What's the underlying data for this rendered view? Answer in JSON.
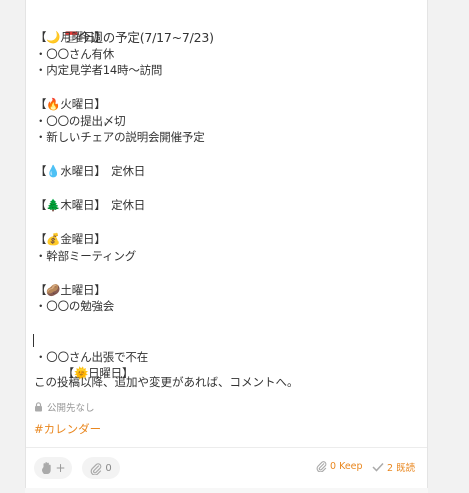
{
  "post": {
    "title": "今週の予定(7/17~7/23)",
    "monday_header": "【🌙月曜日】",
    "monday_items": [
      "・〇〇さん有休",
      "・内定見学者14時～訪問"
    ],
    "tuesday_header": "【🔥火曜日】",
    "tuesday_items": [
      "・〇〇の提出〆切",
      "・新しいチェアの説明会開催予定"
    ],
    "wednesday_line": "【💧水曜日】　定休日",
    "thursday_line": "【🌲木曜日】　定休日",
    "friday_header": "【💰金曜日】",
    "friday_items": [
      "・幹部ミーティング"
    ],
    "saturday_header": "【🥔土曜日】",
    "saturday_items": [
      "・〇〇の勉強会"
    ],
    "sunday_header": "【🌞日曜日】",
    "sunday_items": [
      "・〇〇さん出張で不在"
    ],
    "closing": "この投稿以降、追加や変更があれば、コメントへ。",
    "visibility": "公開先なし",
    "hashtag": "#カレンダー"
  },
  "footer": {
    "reaction_plus": "+",
    "attach_count": "0",
    "keep_label": "0 Keep",
    "read_label": "2 既読"
  },
  "colors": {
    "accent": "#e9871f",
    "muted": "#999999",
    "text": "#333333",
    "side_bg": "#f2f2f2"
  }
}
